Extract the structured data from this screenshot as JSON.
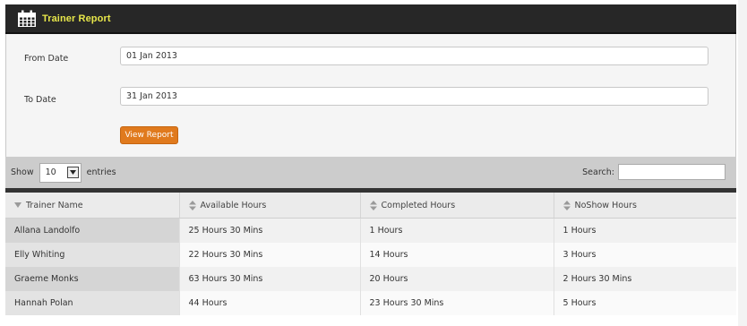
{
  "header": {
    "title": "Trainer Report",
    "icon": "calendar-icon"
  },
  "form": {
    "from_label": "From Date",
    "from_value": "01 Jan 2013",
    "to_label": "To Date",
    "to_value": "31 Jan 2013",
    "button_label": "View Report"
  },
  "toolbar": {
    "show_label": "Show",
    "length_value": "10",
    "entries_label": "entries",
    "search_label": "Search:"
  },
  "table": {
    "columns": [
      "Trainer Name",
      "Available Hours",
      "Completed Hours",
      "NoShow Hours"
    ],
    "rows": [
      [
        "Allana Landolfo",
        "25 Hours 30 Mins",
        "1 Hours",
        "1 Hours"
      ],
      [
        "Elly Whiting",
        "22 Hours 30 Mins",
        "14 Hours",
        "3 Hours"
      ],
      [
        "Graeme Monks",
        "63 Hours 30 Mins",
        "20 Hours",
        "2 Hours 30 Mins"
      ],
      [
        "Hannah Polan",
        "44 Hours",
        "23 Hours 30 Mins",
        "5 Hours"
      ]
    ]
  },
  "colors": {
    "accent": "#e07a1d",
    "title": "#e7e64a",
    "header_bg": "#272727"
  }
}
